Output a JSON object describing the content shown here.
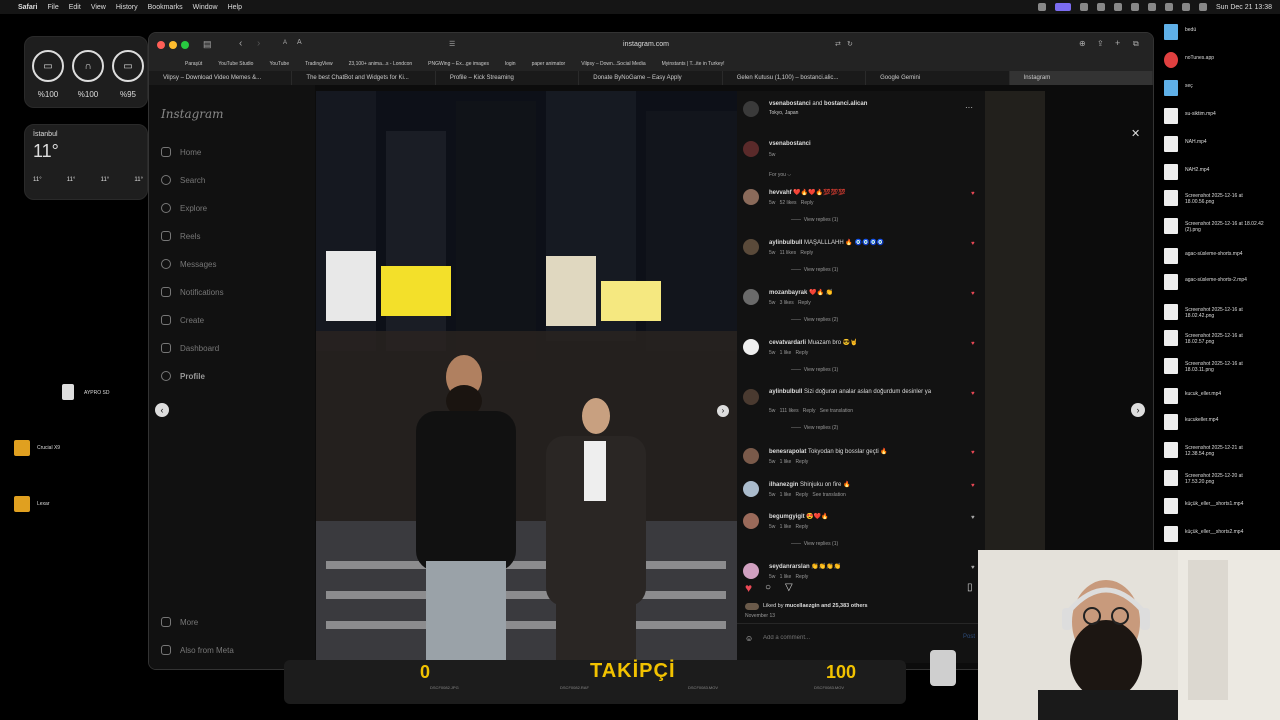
{
  "menubar": {
    "app": "Safari",
    "items": [
      "File",
      "Edit",
      "View",
      "History",
      "Bookmarks",
      "Window",
      "Help"
    ],
    "clock": "Sun Dec 21  13:38"
  },
  "widgets": {
    "batteries": [
      "%100",
      "%100",
      "%95"
    ],
    "weather": {
      "city": "İstanbul",
      "temp": "11°",
      "lows": [
        "11°",
        "11°",
        "11°",
        "11°"
      ]
    }
  },
  "desktop_left": {
    "drives": [
      "AYPRO SD",
      "Crucial X9",
      "Lexar"
    ]
  },
  "browser": {
    "url": "instagram.com",
    "favorites": [
      "Paraşüt",
      "YouTube Studio",
      "YouTube",
      "TradingView",
      "23,100+ anima...s - Londcon",
      "PNGWing – Ex...ge images",
      "login",
      "paper animator",
      "Vilpsy – Down...Social Media",
      "Myinstants | T...ite in Turkey!"
    ],
    "tabs": [
      "Vilpsy – Download Video Memes &...",
      "The best ChatBot and Widgets for Ki...",
      "Profile – Kick Streaming",
      "Donate ByNoGame – Easy Apply",
      "Gelen Kutusu (1,100) – bostanci.alic...",
      "Google Gemini",
      "Instagram"
    ]
  },
  "instagram": {
    "logo": "Instagram",
    "nav": [
      "Home",
      "Search",
      "Explore",
      "Reels",
      "Messages",
      "Notifications",
      "Create",
      "Dashboard",
      "Profile"
    ],
    "bottom_nav": [
      "More",
      "Also from Meta"
    ],
    "post": {
      "header_user_a": "vsenabostanci",
      "header_and": "and",
      "header_user_b": "bostanci.alican",
      "location": "Tokyo, Japan",
      "caption_user": "vsenabostanci",
      "caption_time": "5w",
      "for_you": "For you ⌵",
      "liked_prefix": "Liked by",
      "liked_user": "mucellaezgin",
      "liked_suffix": "and 25,383 others",
      "date": "November 13",
      "add_comment_placeholder": "Add a comment...",
      "post_label": "Post"
    },
    "comments": [
      {
        "user": "hevvahf",
        "text": "❤️🔥❤️🔥💯💯💯",
        "time": "5w",
        "likes": "52 likes",
        "reply": "Reply",
        "replies": "View replies (1)"
      },
      {
        "user": "aylinbulbull",
        "text": "MAŞALLLAHH 🔥 🧿🧿🧿🧿",
        "time": "5w",
        "likes": "11 likes",
        "reply": "Reply",
        "replies": "View replies (1)"
      },
      {
        "user": "mozanbayrak",
        "text": "❤️🔥 👏",
        "time": "5w",
        "likes": "3 likes",
        "reply": "Reply",
        "replies": "View replies (2)"
      },
      {
        "user": "cevatvardarli",
        "text": "Muazam bro 😎🤘",
        "time": "5w",
        "likes": "1 like",
        "reply": "Reply",
        "replies": "View replies (1)"
      },
      {
        "user": "aylinbulbull",
        "text": "Sizi doğuran analar aslan doğurdum desinler ya",
        "time": "5w",
        "likes": "111 likes",
        "reply": "Reply",
        "translate": "See translation",
        "replies": "View replies (2)"
      },
      {
        "user": "benesrapolat",
        "text": "Tokyodan big bosslar geçti 🔥",
        "time": "5w",
        "likes": "1 like",
        "reply": "Reply"
      },
      {
        "user": "ilhanezgin",
        "text": "Shinjuku on fire 🔥",
        "time": "5w",
        "likes": "1 like",
        "reply": "Reply",
        "translate": "See translation"
      },
      {
        "user": "begumgyigit",
        "text": "😍❤️🔥",
        "time": "5w",
        "likes": "1 like",
        "reply": "Reply",
        "replies": "View replies (1)"
      },
      {
        "user": "seydanrarslan",
        "text": "👏👏👏👏",
        "time": "5w",
        "likes": "1 like",
        "reply": "Reply"
      }
    ]
  },
  "desktop_right": {
    "files": [
      "bedü",
      "noTunes.app",
      "seç",
      "su-siktim.mp4",
      "NAH.mp4",
      "NAH2.mp4",
      "Screenshot 2025-12-16 at 18.00.56.png",
      "Screenshot 2025-12-16 at 18.02.42 (2).png",
      "agac-süsleme-shorts.mp4",
      "agac-süsleme-shorts-2.mp4",
      "Screenshot 2025-12-16 at 18.02.42.png",
      "Screenshot 2025-12-16 at 18.02.57.png",
      "Screenshot 2025-12-16 at 18.03.11.png",
      "kucuk_eller.mp4",
      "kucukeller.mp4",
      "Screenshot 2025-12-21 at 12.38.54.png",
      "Screenshot 2025-12-20 at 17.53.20.png",
      "küçük_eller__shorts1.mp4",
      "küçük_eller__shorts2.mp4"
    ]
  },
  "overlay": {
    "left_count": "0",
    "label": "TAKİPÇİ",
    "right_count": "100",
    "dock_files": [
      "DSCF0082.JPG",
      "DSCF0082.RAF",
      "DSCF0083.MOV",
      "DSCF0083.MOV"
    ]
  },
  "colors": {
    "accent_blue": "#0095f6",
    "heart_red": "#ed4956",
    "overlay_yellow": "#f2c200"
  }
}
